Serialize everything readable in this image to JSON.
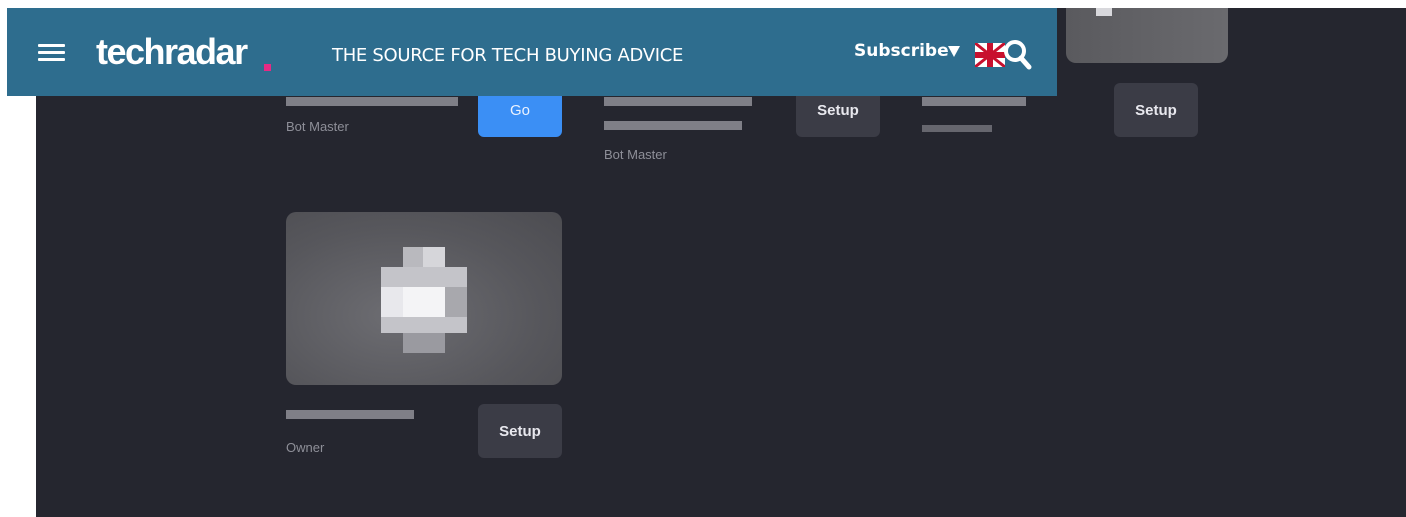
{
  "header": {
    "brand": "techradar",
    "tagline": "THE SOURCE FOR TECH BUYING ADVICE",
    "subscribe_label": "Subscribe",
    "accent": "#2e6d8e",
    "brand_dot_color": "#e62a84"
  },
  "servers": [
    {
      "role": "Bot Master",
      "action": "Go"
    },
    {
      "role": "Bot Master",
      "action": "Setup"
    },
    {
      "role": "",
      "action": "Setup"
    },
    {
      "role": "Owner",
      "action": "Setup"
    }
  ],
  "colors": {
    "background": "#25262f",
    "go_button": "#3b8ff5",
    "setup_button": "#3b3c46"
  }
}
